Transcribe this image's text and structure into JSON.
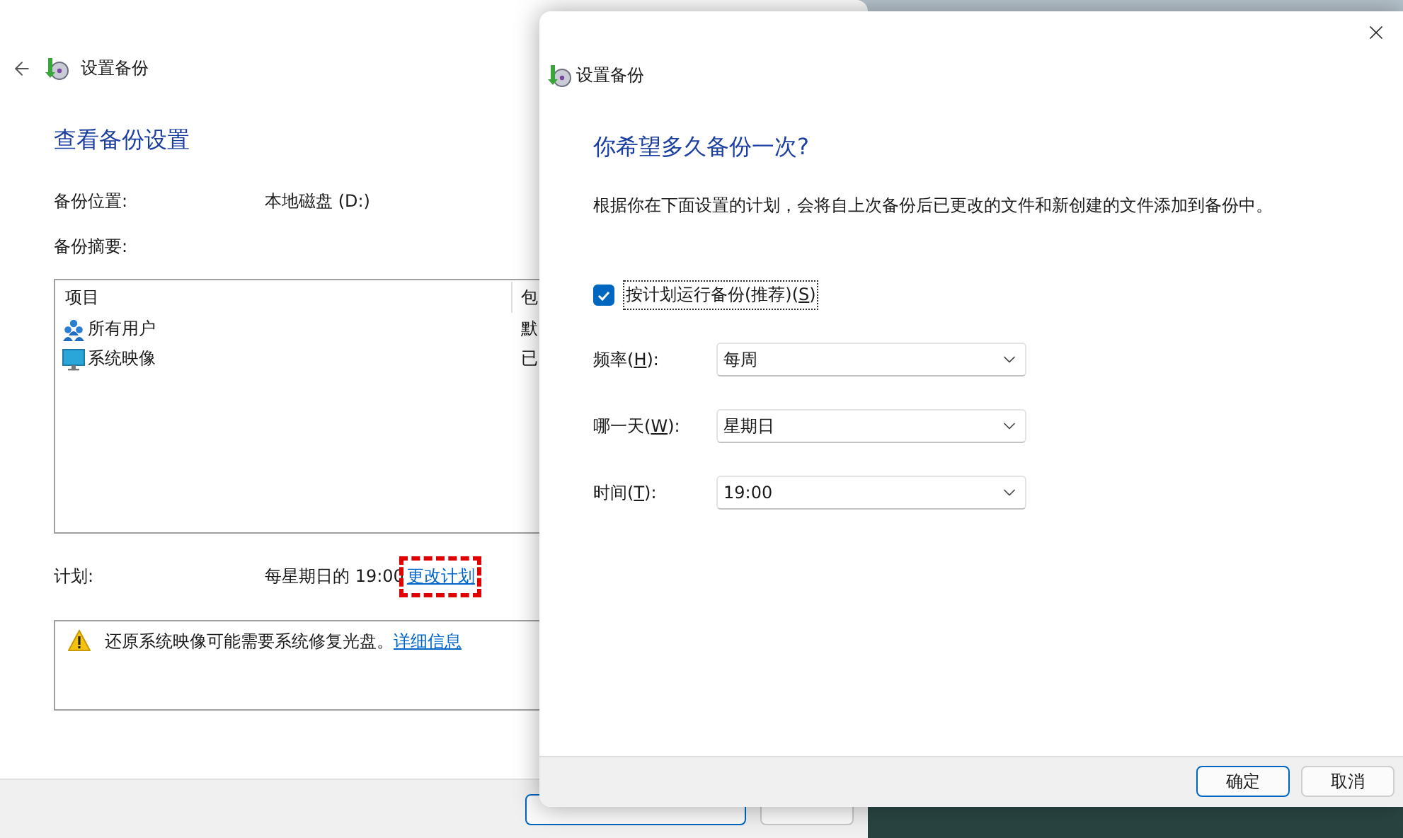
{
  "back_window": {
    "title": "设置备份",
    "heading": "查看备份设置",
    "location": {
      "label": "备份位置:",
      "value": "本地磁盘 (D:)"
    },
    "summary_label": "备份摘要:",
    "table": {
      "columns": [
        "项目",
        "包"
      ],
      "rows": [
        {
          "kind": "users",
          "cells": [
            "所有用户",
            "默"
          ]
        },
        {
          "kind": "monitor",
          "cells": [
            "系统映像",
            "已"
          ]
        }
      ]
    },
    "schedule": {
      "label": "计划:",
      "value": "每星期日的 19:00",
      "link": "更改计划",
      "highlighted": true
    },
    "warning": {
      "text": "还原系统映像可能需要系统修复光盘。",
      "link": "详细信息"
    }
  },
  "dialog": {
    "title": "设置备份",
    "heading": "你希望多久备份一次?",
    "description": "根据你在下面设置的计划，会将自上次备份后已更改的文件和新创建的文件添加到备份中。",
    "schedule_checkbox": {
      "label_before": "按计划运行备份(推荐)(",
      "key": "S",
      "label_after": ")",
      "checked": true
    },
    "fields": [
      {
        "label_before": "频率(",
        "key": "H",
        "label_after": "):",
        "value": "每周"
      },
      {
        "label_before": "哪一天(",
        "key": "W",
        "label_after": "):",
        "value": "星期日"
      },
      {
        "label_before": "时间(",
        "key": "T",
        "label_after": "):",
        "value": "19:00"
      }
    ],
    "buttons": [
      {
        "label": "确定",
        "default": true
      },
      {
        "label": "取消",
        "default": false
      }
    ]
  }
}
